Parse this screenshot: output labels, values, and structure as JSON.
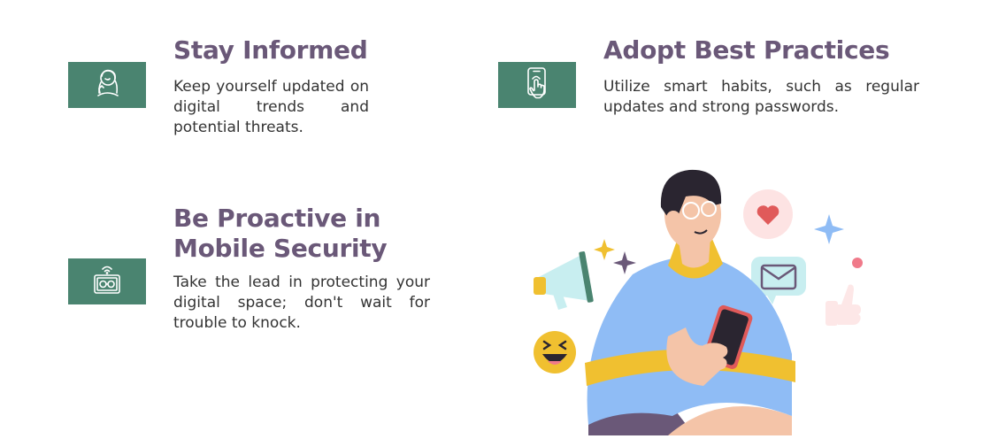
{
  "colors": {
    "accent_green": "#4a8470",
    "heading_purple": "#6a5878",
    "body_text": "#333333"
  },
  "sections": [
    {
      "title": "Stay Informed",
      "body": "Keep yourself updated on digital trends and potential threats.",
      "icon": "person-thinking-icon"
    },
    {
      "title": "Adopt Best Practices",
      "body": "Utilize smart habits, such as regular updates and strong passwords.",
      "icon": "phone-touch-icon"
    },
    {
      "title_line1": "Be Proactive in",
      "title_line2": "Mobile Security",
      "body": "Take the lead in protecting your digital space; don't wait for trouble to knock.",
      "icon": "wifi-glasses-device-icon"
    }
  ],
  "illustration": {
    "subject": "man-using-phone-illustration",
    "elements": [
      "megaphone-icon",
      "laughing-emoji-icon",
      "heart-bubble-icon",
      "mail-bubble-icon",
      "thumbs-up-icon",
      "sparkle-icon",
      "star-icon"
    ],
    "colors": {
      "shirt_blue": "#8fbcf5",
      "stripe_yellow": "#f0c030",
      "skin": "#f4c4a8",
      "hair": "#2a2530",
      "phone": "#2a2530",
      "phone_case": "#e05a5a",
      "heart_red": "#e05a5a",
      "bubble_pink": "#fde3e3",
      "bubble_teal": "#c8eef0",
      "megaphone_teal": "#c8eef0",
      "emoji_yellow": "#f0c030"
    }
  }
}
